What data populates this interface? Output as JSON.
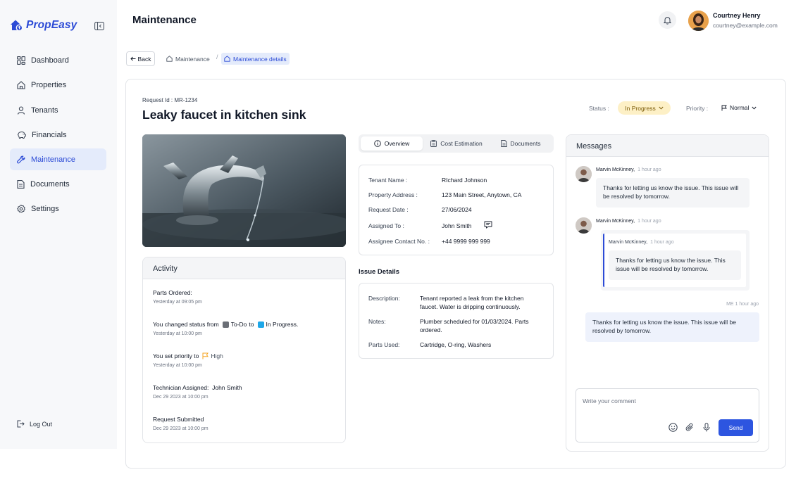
{
  "app": {
    "name": "PropEasy"
  },
  "sidebar": {
    "items": [
      {
        "label": "Dashboard",
        "icon": "dashboard-icon"
      },
      {
        "label": "Properties",
        "icon": "home-icon"
      },
      {
        "label": "Tenants",
        "icon": "user-icon"
      },
      {
        "label": "Financials",
        "icon": "piggy-bank-icon"
      },
      {
        "label": "Maintenance",
        "icon": "wrench-icon",
        "active": true
      },
      {
        "label": "Documents",
        "icon": "document-icon"
      },
      {
        "label": "Settings",
        "icon": "gear-icon"
      }
    ],
    "logout": "Log Out"
  },
  "header": {
    "title": "Maintenance",
    "user": {
      "name": "Courtney Henry",
      "email": "courtney@example.com"
    }
  },
  "breadcrumb": {
    "back": "Back",
    "items": [
      "Maintenance",
      "/",
      "Maintenance details"
    ]
  },
  "request": {
    "id_text": "Request Id : MR-1234",
    "title": "Leaky faucet in kitchen sink",
    "status_label": "Status :",
    "status": "In Progress",
    "priority_label": "Priority :",
    "priority": "Normal"
  },
  "activity": {
    "title": "Activity",
    "items": [
      {
        "text": "Parts Ordered:",
        "time": "Yesterday at 09:05 pm"
      },
      {
        "prefix": "You changed status from",
        "from": "To-Do",
        "middle": "to",
        "to": "In Progress.",
        "time": "Yesterday at 10:00 pm"
      },
      {
        "prefix": "You set priority to",
        "value": "High",
        "time": "Yesterday at 10:00 pm"
      },
      {
        "text": "Technician Assigned:  John Smith",
        "time": "Dec 29 2023 at 10:00 pm"
      },
      {
        "text": "Request Submitted",
        "time": "Dec 29 2023 at 10:00 pm"
      }
    ]
  },
  "tabs": [
    "Overview",
    "Cost Estimation",
    "Documents"
  ],
  "overview": {
    "rows": [
      {
        "label": "Tenant Name :",
        "value": "RIchard Johnson"
      },
      {
        "label": "Property Address :",
        "value": "123 Main Street, Anytown, CA"
      },
      {
        "label": "Request Date :",
        "value": "27/06/2024"
      },
      {
        "label": "Assigned To :",
        "value": "John Smith"
      },
      {
        "label": "Assignee Contact No. :",
        "value": "+44 9999 999 999"
      }
    ]
  },
  "issue": {
    "title": "Issue Details",
    "rows": [
      {
        "label": "Description:",
        "value": "Tenant reported a leak from the kitchen faucet. Water is dripping continuously."
      },
      {
        "label": "Notes:",
        "value": "Plumber scheduled for 01/03/2024. Parts ordered."
      },
      {
        "label": "Parts Used:",
        "value": "Cartridge, O-ring, Washers"
      }
    ]
  },
  "messages": {
    "title": "Messages",
    "items": [
      {
        "name": "Marvin McKinney,",
        "time": "1 hour ago",
        "text": "Thanks for letting us know the issue. This issue will be resolved by tomorrow."
      },
      {
        "name": "Marvin McKinney,",
        "time": "1 hour ago",
        "quote": {
          "name": "Marvin McKinney,",
          "time": "1 hour ago",
          "text": "Thanks for letting us know the issue. This issue will be resolved by tomorrow."
        }
      }
    ],
    "mine": {
      "time": "ME 1 hour ago",
      "text": "Thanks for letting us know the issue. This issue will be resolved by tomorrow."
    },
    "composer": {
      "placeholder": "Write your comment",
      "send": "Send"
    }
  },
  "colors": {
    "accent": "#2c4bd6",
    "status_bg": "#fdf0c6",
    "todo": "#6b6f76",
    "in_progress": "#1ea7e8",
    "high": "#f5a623"
  }
}
